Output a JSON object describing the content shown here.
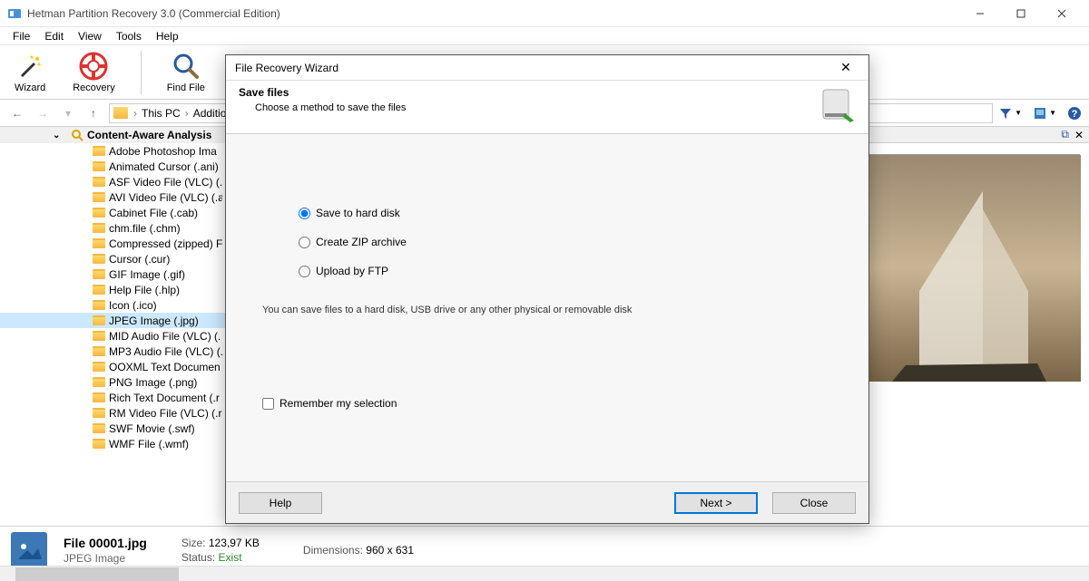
{
  "window": {
    "title": "Hetman Partition Recovery 3.0 (Commercial Edition)"
  },
  "menu": {
    "file": "File",
    "edit": "Edit",
    "view": "View",
    "tools": "Tools",
    "help": "Help"
  },
  "toolbar": {
    "wizard": "Wizard",
    "recovery": "Recovery",
    "findfile": "Find File"
  },
  "breadcrumb": {
    "p1": "This PC",
    "p2": "Additio"
  },
  "tree": {
    "root": "Content-Aware Analysis",
    "items": [
      "Adobe Photoshop Ima",
      "Animated Cursor (.ani)",
      "ASF Video File (VLC) (.a",
      "AVI Video File (VLC) (.av",
      "Cabinet File (.cab)",
      "chm.file (.chm)",
      "Compressed (zipped) F",
      "Cursor (.cur)",
      "GIF Image (.gif)",
      "Help File (.hlp)",
      "Icon (.ico)",
      "JPEG Image (.jpg)",
      "MID Audio File (VLC) (.",
      "MP3 Audio File (VLC) (.",
      "OOXML Text Documen",
      "PNG Image (.png)",
      "Rich Text Document (.r",
      "RM Video File (VLC) (.rr",
      "SWF Movie (.swf)",
      "WMF File (.wmf)"
    ],
    "selected_index": 11
  },
  "footer": {
    "filename": "File 00001.jpg",
    "filetype": "JPEG Image",
    "size_label": "Size:",
    "size_value": "123,97 KB",
    "dim_label": "Dimensions:",
    "dim_value": "960 x 631",
    "status_label": "Status:",
    "status_value": "Exist"
  },
  "dialog": {
    "title": "File Recovery Wizard",
    "heading": "Save files",
    "subheading": "Choose a method to save the files",
    "opt1": "Save to hard disk",
    "opt2": "Create ZIP archive",
    "opt3": "Upload by FTP",
    "hint": "You can save files to a hard disk, USB drive or any other physical or removable disk",
    "remember": "Remember my selection",
    "help": "Help",
    "next": "Next  >",
    "close": "Close"
  }
}
